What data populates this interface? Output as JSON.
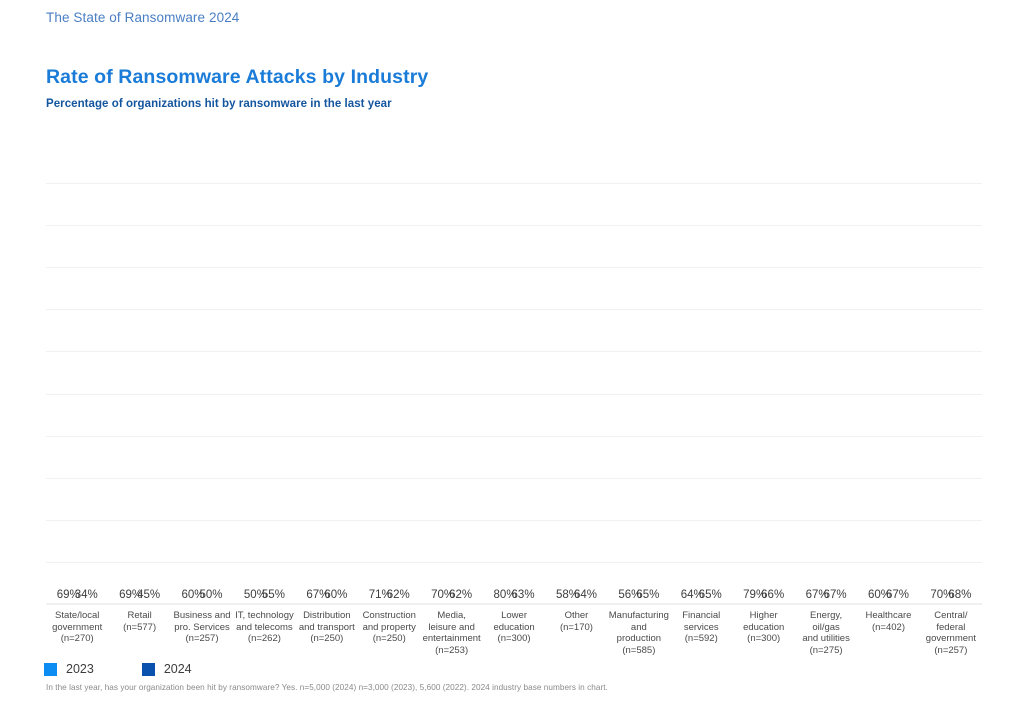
{
  "header": {
    "breadcrumb": "The State of Ransomware 2024",
    "title": "Rate of Ransomware Attacks by Industry",
    "subtitle": "Percentage of organizations hit by ransomware in the last year"
  },
  "legend": {
    "items": [
      {
        "label": "2023",
        "color": "#0d8cf2"
      },
      {
        "label": "2024",
        "color": "#0b51ae"
      }
    ]
  },
  "footnote": "In the last year, has your organization been hit by ransomware? Yes. n=5,000 (2024) n=3,000 (2023), 5,600 (2022). 2024 industry base numbers in chart.",
  "chart_data": {
    "type": "bar",
    "title": "Rate of Ransomware Attacks by Industry",
    "subtitle": "Percentage of organizations hit by ransomware in the last year",
    "xlabel": "",
    "ylabel": "",
    "ylim": [
      0,
      100
    ],
    "grid": true,
    "legend_position": "bottom-left",
    "value_format": "percent",
    "categories": [
      "State/local government",
      "Retail",
      "Business and pro. Services",
      "IT, technology and telecoms",
      "Distribution and transport",
      "Construction and property",
      "Media, leisure and entertainment",
      "Lower education",
      "Other",
      "Manufacturing and production",
      "Financial services",
      "Higher education",
      "Energy, oil/gas and utilities",
      "Healthcare",
      "Central/federal government"
    ],
    "category_lines": [
      [
        "State/local",
        "government",
        "(n=270)"
      ],
      [
        "Retail",
        "(n=577)"
      ],
      [
        "Business and",
        "pro. Services",
        "(n=257)"
      ],
      [
        "IT, technology",
        "and telecoms",
        "(n=262)"
      ],
      [
        "Distribution",
        "and transport",
        "(n=250)"
      ],
      [
        "Construction",
        "and property",
        "(n=250)"
      ],
      [
        "Media,",
        "leisure and",
        "entertainment",
        "(n=253)"
      ],
      [
        "Lower",
        "education",
        "(n=300)"
      ],
      [
        "Other",
        "(n=170)"
      ],
      [
        "Manufacturing",
        "and",
        "production",
        "(n=585)"
      ],
      [
        "Financial",
        "services",
        "(n=592)"
      ],
      [
        "Higher",
        "education",
        "(n=300)"
      ],
      [
        "Energy, oil/gas",
        "and utilities",
        "(n=275)"
      ],
      [
        "Healthcare",
        "(n=402)"
      ],
      [
        "Central/",
        "federal",
        "government",
        "(n=257)"
      ]
    ],
    "base_sizes": [
      "n=270",
      "n=577",
      "n=257",
      "n=262",
      "n=250",
      "n=250",
      "n=253",
      "n=300",
      "n=170",
      "n=585",
      "n=592",
      "n=300",
      "n=275",
      "n=402",
      "n=257"
    ],
    "series": [
      {
        "name": "2023",
        "color": "#0d8cf2",
        "values": [
          69,
          69,
          60,
          50,
          67,
          71,
          70,
          80,
          58,
          56,
          64,
          79,
          67,
          60,
          70
        ],
        "labels": [
          "69%",
          "69%",
          "60%",
          "50%",
          "67%",
          "71%",
          "70%",
          "80%",
          "58%",
          "56%",
          "64%",
          "79%",
          "67%",
          "60%",
          "70%"
        ]
      },
      {
        "name": "2024",
        "color": "#0b51ae",
        "values": [
          34,
          45,
          50,
          55,
          60,
          62,
          62,
          63,
          64,
          65,
          65,
          66,
          67,
          67,
          68
        ],
        "labels": [
          "34%",
          "45%",
          "50%",
          "55%",
          "60%",
          "62%",
          "62%",
          "63%",
          "64%",
          "65%",
          "65%",
          "66%",
          "67%",
          "67%",
          "68%"
        ]
      }
    ]
  }
}
